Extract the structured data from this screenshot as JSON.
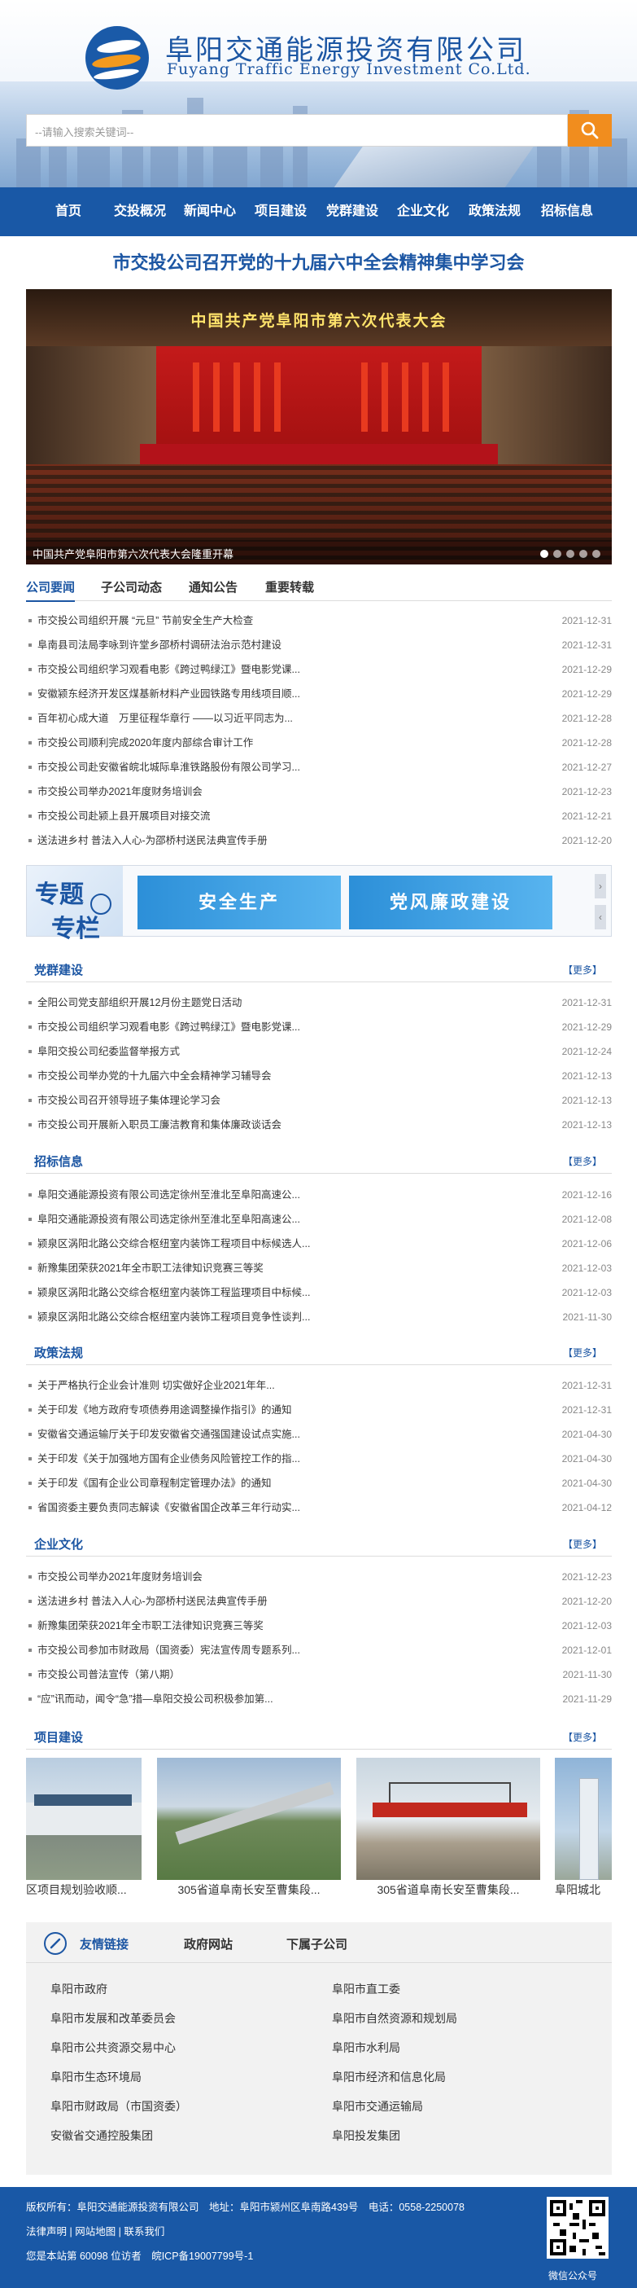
{
  "header": {
    "brand_cn": "阜阳交通能源投资有限公司",
    "brand_en": "Fuyang Traffic Energy Investment Co.Ltd.",
    "search_placeholder": "--请输入搜索关键词--",
    "search_icon": "search-icon",
    "accent": "#1958a6",
    "search_button_color": "#f18d1e"
  },
  "nav": [
    "首页",
    "交投概况",
    "新闻中心",
    "项目建设",
    "党群建设",
    "企业文化",
    "政策法规",
    "招标信息"
  ],
  "headline": "市交投公司召开党的十九届六中全会精神集中学习会",
  "banner": {
    "stage_title": "中国共产党阜阳市第六次代表大会",
    "caption": "中国共产党阜阳市第六次代表大会隆重开幕",
    "slide_count": 5,
    "active_slide": 1
  },
  "news_tabs": [
    "公司要闻",
    "子公司动态",
    "通知公告",
    "重要转载"
  ],
  "news": [
    {
      "title": "市交投公司组织开展 “元旦” 节前安全生产大检查",
      "date": "2021-12-31"
    },
    {
      "title": "阜南县司法局李咏到许堂乡邵桥村调研法治示范村建设",
      "date": "2021-12-31"
    },
    {
      "title": "市交投公司组织学习观看电影《跨过鸭绿江》暨电影党课...",
      "date": "2021-12-29"
    },
    {
      "title": "安徽颍东经济开发区煤基新材料产业园铁路专用线项目顺...",
      "date": "2021-12-29"
    },
    {
      "title": "百年初心成大道　万里征程华章行 ——以习近平同志为...",
      "date": "2021-12-28"
    },
    {
      "title": "市交投公司顺利完成2020年度内部综合审计工作",
      "date": "2021-12-28"
    },
    {
      "title": "市交投公司赴安徽省皖北城际阜淮铁路股份有限公司学习...",
      "date": "2021-12-27"
    },
    {
      "title": "市交投公司举办2021年度财务培训会",
      "date": "2021-12-23"
    },
    {
      "title": "市交投公司赴颍上县开展项目对接交流",
      "date": "2021-12-21"
    },
    {
      "title": "送法进乡村 普法入人心-为邵桥村送民法典宣传手册",
      "date": "2021-12-20"
    }
  ],
  "topic": {
    "label_1": "专题",
    "label_2": "专栏",
    "cards": [
      "安全生产",
      "党风廉政建设"
    ],
    "prev": "‹",
    "next": "›"
  },
  "more_label": "【更多】",
  "party": {
    "title": "党群建设",
    "items": [
      {
        "title": "全阳公司党支部组织开展12月份主题党日活动",
        "date": "2021-12-31"
      },
      {
        "title": "市交投公司组织学习观看电影《跨过鸭绿江》暨电影党课...",
        "date": "2021-12-29"
      },
      {
        "title": "阜阳交投公司纪委监督举报方式",
        "date": "2021-12-24"
      },
      {
        "title": "市交投公司举办党的十九届六中全会精神学习辅导会",
        "date": "2021-12-13"
      },
      {
        "title": "市交投公司召开领导班子集体理论学习会",
        "date": "2021-12-13"
      },
      {
        "title": "市交投公司开展新入职员工廉洁教育和集体廉政谈话会",
        "date": "2021-12-13"
      }
    ]
  },
  "bid": {
    "title": "招标信息",
    "items": [
      {
        "title": "阜阳交通能源投资有限公司选定徐州至淮北至阜阳高速公...",
        "date": "2021-12-16"
      },
      {
        "title": "阜阳交通能源投资有限公司选定徐州至淮北至阜阳高速公...",
        "date": "2021-12-08"
      },
      {
        "title": "颍泉区涡阳北路公交综合枢纽室内装饰工程项目中标候选人...",
        "date": "2021-12-06"
      },
      {
        "title": "新豫集团荣获2021年全市职工法律知识竞赛三等奖",
        "date": "2021-12-03"
      },
      {
        "title": "颍泉区涡阳北路公交综合枢纽室内装饰工程监理项目中标候...",
        "date": "2021-12-03"
      },
      {
        "title": "颍泉区涡阳北路公交综合枢纽室内装饰工程项目竞争性谈判...",
        "date": "2021-11-30"
      }
    ]
  },
  "policy": {
    "title": "政策法规",
    "items": [
      {
        "title": "关于严格执行企业会计准则 切实做好企业2021年年...",
        "date": "2021-12-31"
      },
      {
        "title": "关于印发《地方政府专项债券用途调整操作指引》的通知",
        "date": "2021-12-31"
      },
      {
        "title": "安徽省交通运输厅关于印发安徽省交通强国建设试点实施...",
        "date": "2021-04-30"
      },
      {
        "title": "关于印发《关于加强地方国有企业债务风险管控工作的指...",
        "date": "2021-04-30"
      },
      {
        "title": "关于印发《国有企业公司章程制定管理办法》的通知",
        "date": "2021-04-30"
      },
      {
        "title": "省国资委主要负责同志解读《安徽省国企改革三年行动实...",
        "date": "2021-04-12"
      }
    ]
  },
  "culture": {
    "title": "企业文化",
    "items": [
      {
        "title": "市交投公司举办2021年度财务培训会",
        "date": "2021-12-23"
      },
      {
        "title": "送法进乡村 普法入人心-为邵桥村送民法典宣传手册",
        "date": "2021-12-20"
      },
      {
        "title": "新豫集团荣获2021年全市职工法律知识竞赛三等奖",
        "date": "2021-12-03"
      },
      {
        "title": "市交投公司参加市财政局（国资委）宪法宣传周专题系列...",
        "date": "2021-12-01"
      },
      {
        "title": "市交投公司普法宣传（第八期）",
        "date": "2021-11-30"
      },
      {
        "title": "“应”讯而动，闻令“急”措—阜阳交投公司积极参加第...",
        "date": "2021-11-29"
      }
    ]
  },
  "projects": {
    "title": "项目建设",
    "items": [
      {
        "caption": "区项目规划验收顺..."
      },
      {
        "caption": "305省道阜南长安至曹集段..."
      },
      {
        "caption": "305省道阜南长安至曹集段..."
      },
      {
        "caption": "阜阳城北"
      }
    ]
  },
  "links": {
    "tabs": [
      "友情链接",
      "政府网站",
      "下属子公司"
    ],
    "icon": "link-icon",
    "left": [
      "阜阳市政府",
      "阜阳市发展和改革委员会",
      "阜阳市公共资源交易中心",
      "阜阳市生态环境局",
      "阜阳市财政局（市国资委）",
      "安徽省交通控股集团"
    ],
    "right": [
      "阜阳市直工委",
      "阜阳市自然资源和规划局",
      "阜阳市水利局",
      "阜阳市经济和信息化局",
      "阜阳市交通运输局",
      "阜阳投发集团"
    ]
  },
  "footer": {
    "line1": "版权所有：阜阳交通能源投资有限公司　地址：阜阳市颍州区阜南路439号　电话：0558-2250078",
    "line2": "法律声明 | 网站地图 | 联系我们",
    "line3": "您是本站第 60098 位访者　皖ICP备19007799号-1",
    "qr_label": "微信公众号"
  }
}
